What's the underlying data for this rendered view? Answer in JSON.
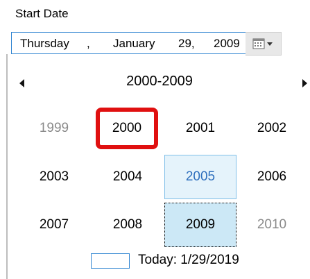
{
  "label": "Start Date",
  "date_picker": {
    "day_name": "Thursday",
    "sep1": ",",
    "month": "January",
    "day": "29,",
    "year": "2009"
  },
  "calendar": {
    "header": "2000-2009",
    "years": [
      {
        "label": "1999",
        "state": "out-of-range"
      },
      {
        "label": "2000",
        "state": "highlighted"
      },
      {
        "label": "2001",
        "state": "normal"
      },
      {
        "label": "2002",
        "state": "normal"
      },
      {
        "label": "2003",
        "state": "normal"
      },
      {
        "label": "2004",
        "state": "normal"
      },
      {
        "label": "2005",
        "state": "hover"
      },
      {
        "label": "2006",
        "state": "normal"
      },
      {
        "label": "2007",
        "state": "normal"
      },
      {
        "label": "2008",
        "state": "normal"
      },
      {
        "label": "2009",
        "state": "selected"
      },
      {
        "label": "2010",
        "state": "out-of-range"
      }
    ],
    "today": "Today: 1/29/2019"
  },
  "colors": {
    "accent": "#2f84d1",
    "highlight_border": "#e01010",
    "hover_bg": "#e5f3fb",
    "selected_bg": "#cce8f6"
  }
}
